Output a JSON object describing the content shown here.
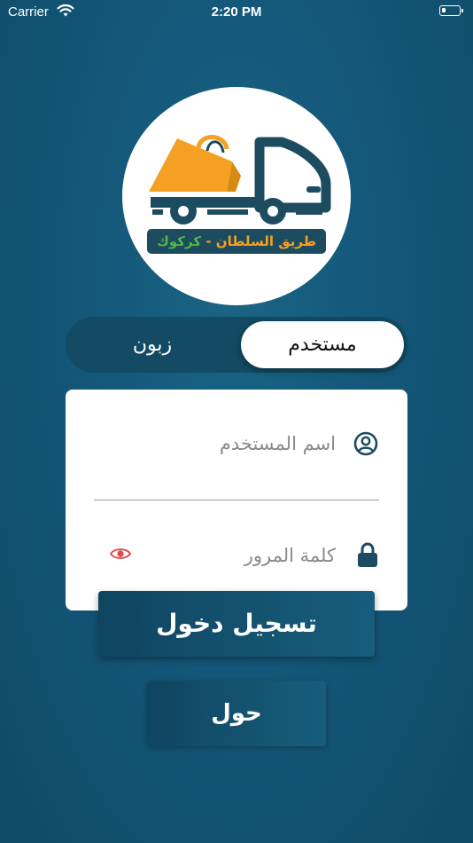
{
  "status_bar": {
    "carrier": "Carrier",
    "time": "2:20 PM"
  },
  "logo": {
    "text_right": "طريق السلطان",
    "text_separator": "-",
    "text_left": "كركوك",
    "colors": {
      "orange": "#f4a023",
      "green": "#52b848",
      "navy": "#1d4b5f"
    }
  },
  "segment": {
    "user_label": "مستخدم",
    "customer_label": "زبون",
    "selected": "مستخدم"
  },
  "form": {
    "username_placeholder": "اسم المستخدم",
    "password_placeholder": "كلمة المرور"
  },
  "buttons": {
    "login_label": "تسجيل دخول",
    "about_label": "حول"
  },
  "icons": {
    "user": "user-circle-icon",
    "lock": "lock-icon",
    "eye": "eye-icon",
    "wifi": "wifi-icon",
    "battery": "battery-icon"
  },
  "colors": {
    "background": "#14587a",
    "toggle_track": "#124b63",
    "button": "#175d7c",
    "eye_icon": "#e04a4a",
    "icon": "#1d4b5f"
  }
}
